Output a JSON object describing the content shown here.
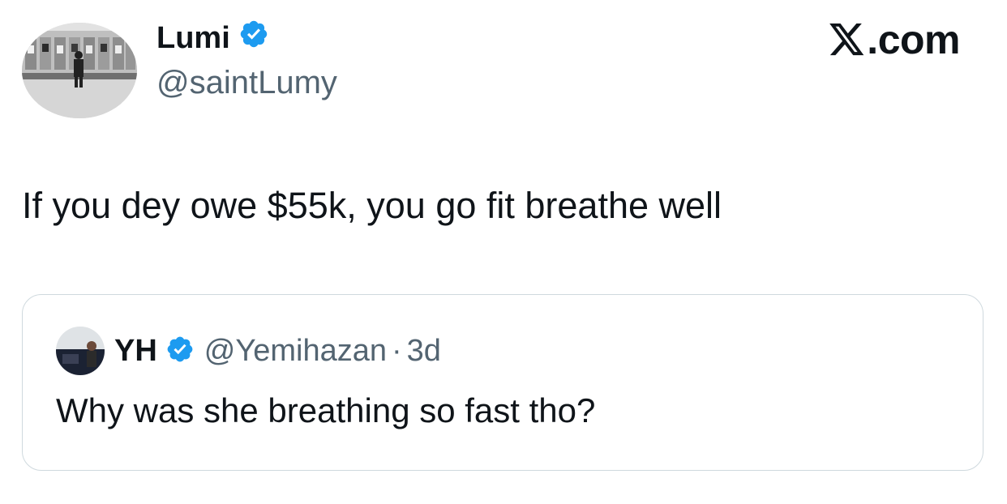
{
  "author": {
    "display_name": "Lumi",
    "handle": "@saintLumy",
    "verified": true,
    "avatar_icon": "profile-photo"
  },
  "brand": {
    "label": ".com",
    "logo_icon": "x-logo-icon"
  },
  "tweet": {
    "text": "If you dey owe $55k, you go fit breathe well"
  },
  "quoted_tweet": {
    "display_name": "YH",
    "handle": "@Yemihazan",
    "separator": "·",
    "time": "3d",
    "verified": true,
    "text": "Why was she breathing so fast tho?"
  },
  "colors": {
    "verified_blue": "#1d9bf0",
    "text_primary": "#0f1419",
    "text_secondary": "#536471",
    "card_border": "#cfd9de"
  }
}
